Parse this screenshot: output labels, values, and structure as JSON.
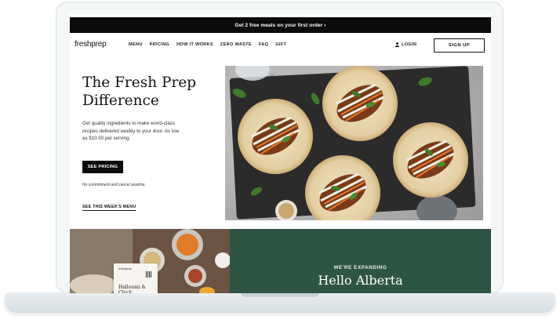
{
  "promo": {
    "text": "Get 2 free meals on your first order ›"
  },
  "nav": {
    "logo": "freshprep",
    "links": [
      "MENU",
      "PRICING",
      "HOW IT WORKS",
      "ZERO WASTE",
      "FAQ",
      "GIFT"
    ],
    "login": "LOGIN",
    "signup": "SIGN UP"
  },
  "hero": {
    "title_line1": "The Fresh Prep",
    "title_line2": "Difference",
    "description": "Get quality ingredients to make world-class recipes delivered weekly to your door. As low as $10.50 per serving.",
    "cta": "SEE PRICING",
    "note": "No commitment and cancel anytime.",
    "menu_link": "SEE THIS WEEK'S MENU"
  },
  "recipe_card": {
    "logo": "freshprep",
    "title": "Halloumi & Chick..."
  },
  "expansion": {
    "eyebrow": "WE'RE EXPANDING",
    "headline": "Hello Alberta"
  },
  "colors": {
    "promo_bg": "#0b0b0b",
    "button_bg": "#0b0b0b",
    "expansion_bg": "#2e5444",
    "slate": "#2b2b2b"
  }
}
